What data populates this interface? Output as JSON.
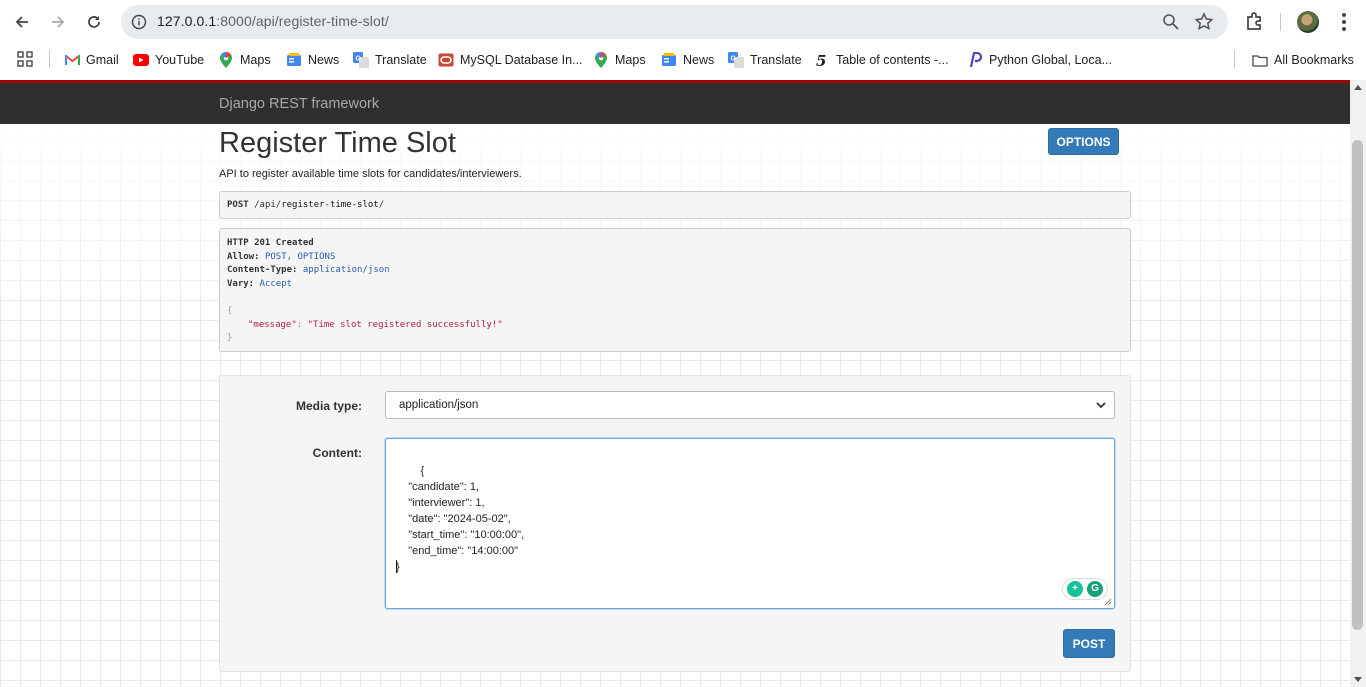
{
  "browser": {
    "url_host": "127.0.0.1",
    "url_rest": ":8000/api/register-time-slot/",
    "bookmarks": [
      {
        "label": "Gmail",
        "icon": "gmail-icon"
      },
      {
        "label": "YouTube",
        "icon": "youtube-icon"
      },
      {
        "label": "Maps",
        "icon": "maps-icon"
      },
      {
        "label": "News",
        "icon": "news-icon"
      },
      {
        "label": "Translate",
        "icon": "translate-icon"
      },
      {
        "label": "MySQL Database In...",
        "icon": "oracle-icon"
      },
      {
        "label": "Maps",
        "icon": "maps-icon"
      },
      {
        "label": "News",
        "icon": "news-icon"
      },
      {
        "label": "Translate",
        "icon": "translate-icon"
      },
      {
        "label": "Table of contents -...",
        "icon": "html5-icon"
      },
      {
        "label": "Python Global, Loca...",
        "icon": "python-icon"
      }
    ],
    "all_bookmarks": "All Bookmarks"
  },
  "page": {
    "brand": "Django REST framework",
    "title": "Register Time Slot",
    "description": "API to register available time slots for candidates/interviewers.",
    "options_label": "OPTIONS",
    "request": {
      "method": "POST",
      "path_prefix": "/api/",
      "path_name": "register-time-slot",
      "path_suffix": "/"
    },
    "response": {
      "status": "HTTP 201 Created",
      "allow_key": "Allow:",
      "allow_value": "POST, OPTIONS",
      "content_type_key": "Content-Type:",
      "content_type_value": "application/json",
      "vary_key": "Vary:",
      "vary_value": "Accept",
      "open_brace": "{",
      "message_key": "\"message\"",
      "colon": ":",
      "message_value": "\"Time slot registered successfully!\"",
      "close_brace": "}"
    },
    "form": {
      "media_type_label": "Media type:",
      "media_type_value": "application/json",
      "content_label": "Content:",
      "content_value": "{\n    \"candidate\": 1,\n    \"interviewer\": 1,\n    \"date\": \"2024-05-02\",\n    \"start_time\": \"10:00:00\",\n    \"end_time\": \"14:00:00\"\n}",
      "post_label": "POST"
    }
  },
  "colors": {
    "accent": "#337ab7",
    "navbar": "#2f2f2f",
    "top_rule": "#a30000",
    "json_string": "#b5203d",
    "header_value": "#2a5caa"
  }
}
